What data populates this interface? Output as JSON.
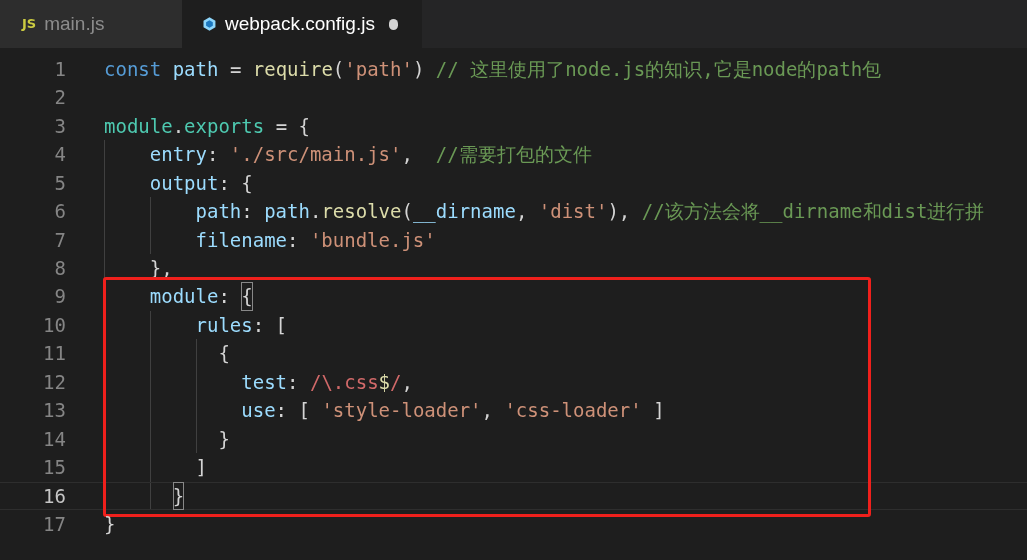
{
  "tabs": [
    {
      "label": "main.js",
      "icon": "JS",
      "kind": "js",
      "selected": false,
      "modified": false
    },
    {
      "label": "webpack.config.js",
      "kind": "webpack",
      "selected": true,
      "modified": true
    }
  ],
  "blocks": [
    {
      "framed": false,
      "lines": [
        {
          "number": "1",
          "current": false,
          "tokens": [
            {
              "kind": "keyword",
              "text": "const"
            },
            {
              "kind": "variable",
              "text": " path"
            },
            {
              "kind": "plain",
              "text": " = "
            },
            {
              "kind": "function",
              "text": "require"
            },
            {
              "kind": "plain",
              "text": "("
            },
            {
              "kind": "string",
              "text": "'path'"
            },
            {
              "kind": "plain",
              "text": ") "
            },
            {
              "kind": "comment",
              "text": "// 这里使用了node.js的知识,它是node的path包"
            }
          ]
        },
        {
          "number": "2",
          "current": false
        },
        {
          "number": "3",
          "current": false,
          "tokens": [
            {
              "kind": "type",
              "text": "module"
            },
            {
              "kind": "plain",
              "text": "."
            },
            {
              "kind": "type",
              "text": "exports"
            },
            {
              "kind": "plain",
              "text": " = {"
            }
          ]
        },
        {
          "number": "4",
          "current": false,
          "tokens": [
            {
              "kind": "variable",
              "text": "    entry"
            },
            {
              "kind": "plain",
              "text": ": "
            },
            {
              "kind": "string",
              "text": "'./src/main.js'"
            },
            {
              "kind": "plain",
              "text": ",  "
            },
            {
              "kind": "comment",
              "text": "//需要打包的文件"
            }
          ]
        },
        {
          "number": "5",
          "current": false,
          "tokens": [
            {
              "kind": "variable",
              "text": "    output"
            },
            {
              "kind": "plain",
              "text": ": {"
            }
          ]
        },
        {
          "number": "6",
          "current": false,
          "tokens": [
            {
              "kind": "variable",
              "text": "        path"
            },
            {
              "kind": "plain",
              "text": ": "
            },
            {
              "kind": "variable",
              "text": "path"
            },
            {
              "kind": "plain",
              "text": "."
            },
            {
              "kind": "function",
              "text": "resolve"
            },
            {
              "kind": "plain",
              "text": "("
            },
            {
              "kind": "variable",
              "text": "__dirname"
            },
            {
              "kind": "plain",
              "text": ", "
            },
            {
              "kind": "string",
              "text": "'dist'"
            },
            {
              "kind": "plain",
              "text": "), "
            },
            {
              "kind": "comment",
              "text": "//该方法会将__dirname和dist进行拼"
            }
          ]
        },
        {
          "number": "7",
          "current": false,
          "tokens": [
            {
              "kind": "variable",
              "text": "        filename"
            },
            {
              "kind": "plain",
              "text": ": "
            },
            {
              "kind": "string",
              "text": "'bundle.js'"
            }
          ]
        },
        {
          "number": "8",
          "current": false,
          "tokens": [
            {
              "kind": "plain",
              "text": "    },"
            }
          ]
        }
      ]
    },
    {
      "framed": true,
      "lines": [
        {
          "number": "9",
          "current": false,
          "tokens": [
            {
              "kind": "variable",
              "text": "    module"
            },
            {
              "kind": "plain",
              "text": ": "
            },
            {
              "kind": "match",
              "text": "{"
            }
          ]
        },
        {
          "number": "10",
          "current": false,
          "tokens": [
            {
              "kind": "variable",
              "text": "        rules"
            },
            {
              "kind": "plain",
              "text": ": ["
            }
          ]
        },
        {
          "number": "11",
          "current": false,
          "tokens": [
            {
              "kind": "plain",
              "text": "          {"
            }
          ]
        },
        {
          "number": "12",
          "current": false,
          "tokens": [
            {
              "kind": "variable",
              "text": "            test"
            },
            {
              "kind": "plain",
              "text": ": "
            },
            {
              "kind": "regex",
              "text": "/\\.css"
            },
            {
              "kind": "function",
              "text": "$"
            },
            {
              "kind": "regex",
              "text": "/"
            },
            {
              "kind": "plain",
              "text": ","
            }
          ]
        },
        {
          "number": "13",
          "current": false,
          "tokens": [
            {
              "kind": "variable",
              "text": "            use"
            },
            {
              "kind": "plain",
              "text": ": [ "
            },
            {
              "kind": "string",
              "text": "'style-loader'"
            },
            {
              "kind": "plain",
              "text": ", "
            },
            {
              "kind": "string",
              "text": "'css-loader'"
            },
            {
              "kind": "plain",
              "text": " ]"
            }
          ]
        },
        {
          "number": "14",
          "current": false,
          "tokens": [
            {
              "kind": "plain",
              "text": "          }"
            }
          ]
        },
        {
          "number": "15",
          "current": false,
          "tokens": [
            {
              "kind": "plain",
              "text": "        ]"
            }
          ]
        },
        {
          "number": "16",
          "current": true,
          "tokens": [
            {
              "kind": "match",
              "text": "      }"
            }
          ]
        }
      ]
    },
    {
      "framed": false,
      "lines": [
        {
          "number": "17",
          "current": false,
          "tokens": [
            {
              "kind": "plain",
              "text": "}"
            }
          ]
        }
      ]
    }
  ]
}
